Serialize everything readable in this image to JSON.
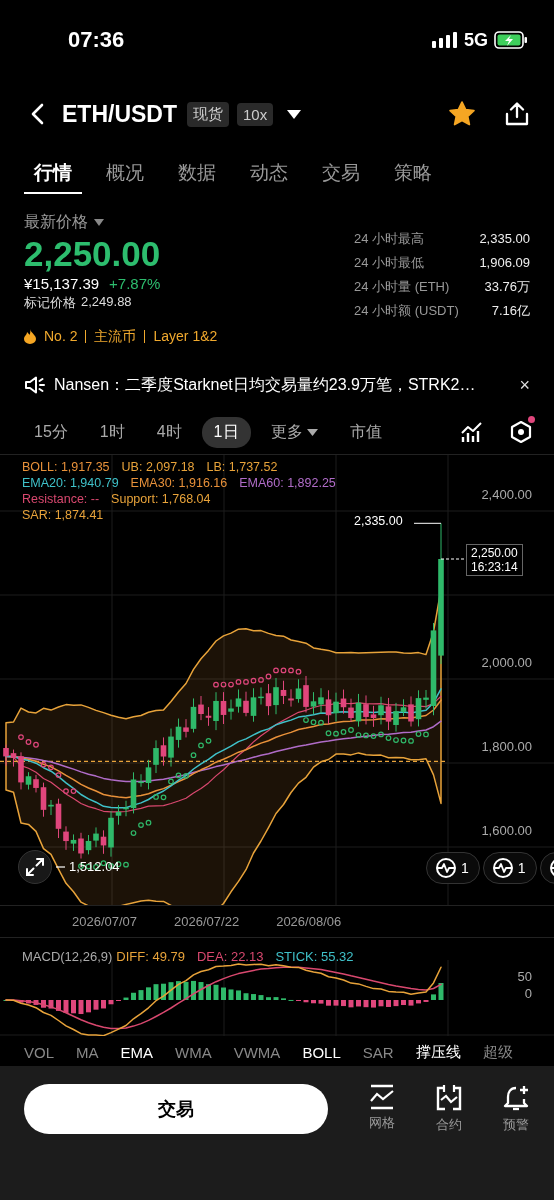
{
  "status_bar": {
    "time": "07:36",
    "network": "5G"
  },
  "header": {
    "pair": "ETH/USDT",
    "badges": [
      "现货",
      "10x"
    ],
    "favorite": true
  },
  "tabs": [
    {
      "label": "行情",
      "selected": true
    },
    {
      "label": "概况",
      "selected": false
    },
    {
      "label": "数据",
      "selected": false
    },
    {
      "label": "动态",
      "selected": false
    },
    {
      "label": "交易",
      "selected": false
    },
    {
      "label": "策略",
      "selected": false
    }
  ],
  "price": {
    "label": "最新价格",
    "last": "2,250.00",
    "cny": "¥15,137.39",
    "change": "+7.87%",
    "mark_label": "标记价格",
    "mark": "2,249.88"
  },
  "stats": [
    {
      "label": "24 小时最高",
      "value": "2,335.00"
    },
    {
      "label": "24 小时最低",
      "value": "1,906.09"
    },
    {
      "label": "24 小时量 (ETH)",
      "value": "33.76万"
    },
    {
      "label": "24 小时额 (USDT)",
      "value": "7.16亿"
    }
  ],
  "tags": [
    "No. 2",
    "主流币",
    "Layer 1&2"
  ],
  "news": {
    "text": "Nansen：二季度Starknet日均交易量约23.9万笔，STRK2…",
    "close": "×"
  },
  "timeframes": [
    {
      "label": "15分",
      "kind": "plain",
      "selected": false
    },
    {
      "label": "1时",
      "kind": "plain",
      "selected": false
    },
    {
      "label": "4时",
      "kind": "plain",
      "selected": false
    },
    {
      "label": "1日",
      "kind": "plain",
      "selected": true
    },
    {
      "label": "更多",
      "kind": "dropdown",
      "selected": false
    },
    {
      "label": "市值",
      "kind": "plain",
      "selected": false
    }
  ],
  "chart": {
    "legend": [
      [
        {
          "text": "BOLL: 1,917.35",
          "color": "#e8913a"
        },
        {
          "text": "UB: 2,097.18",
          "color": "#e8a33a"
        },
        {
          "text": "LB: 1,737.52",
          "color": "#e8a33a"
        }
      ],
      [
        {
          "text": "EMA20: 1,940.79",
          "color": "#3fc1c9"
        },
        {
          "text": "EMA30: 1,916.16",
          "color": "#e8913a"
        },
        {
          "text": "EMA60: 1,892.25",
          "color": "#b06cc8"
        }
      ],
      [
        {
          "text": "Resistance: --",
          "color": "#d9486f"
        },
        {
          "text": "Support: 1,768.04",
          "color": "#e8a33a"
        }
      ],
      [
        {
          "text": "SAR: 1,874.41",
          "color": "#e8a33a"
        }
      ]
    ],
    "y_labels": [
      "2,400.00",
      "2,000.00",
      "1,800.00",
      "1,600.00"
    ],
    "high_marker": "2,335.00",
    "low_marker": "1,512.04",
    "current_price": "2,250.00",
    "countdown": "16:23:14",
    "signal_badges": [
      {
        "kind": "count",
        "count": "1"
      },
      {
        "kind": "count",
        "count": "1"
      },
      {
        "kind": "icon"
      }
    ],
    "dates": [
      "2026/07/07",
      "2026/07/22",
      "2026/08/06"
    ]
  },
  "macd": {
    "title": "MACD(12,26,9)",
    "values": [
      {
        "text": "DIFF: 49.79",
        "color": "#e8a33a"
      },
      {
        "text": "DEA: 22.13",
        "color": "#d9486f"
      },
      {
        "text": "STICK: 55.32",
        "color": "#3fc1c9"
      }
    ],
    "y_labels": [
      "50",
      "0"
    ]
  },
  "indicators": [
    {
      "label": "VOL",
      "selected": false
    },
    {
      "label": "MA",
      "selected": false
    },
    {
      "label": "EMA",
      "selected": true
    },
    {
      "label": "WMA",
      "selected": false
    },
    {
      "label": "VWMA",
      "selected": false
    },
    {
      "label": "BOLL",
      "selected": true
    },
    {
      "label": "SAR",
      "selected": false
    },
    {
      "label": "撑压线",
      "selected": true
    },
    {
      "label": "超级",
      "selected": false
    }
  ],
  "bottom": {
    "trade": "交易",
    "actions": [
      {
        "label": "网格",
        "kind": "grid"
      },
      {
        "label": "合约",
        "kind": "contract"
      },
      {
        "label": "预警",
        "kind": "alert"
      }
    ]
  }
}
